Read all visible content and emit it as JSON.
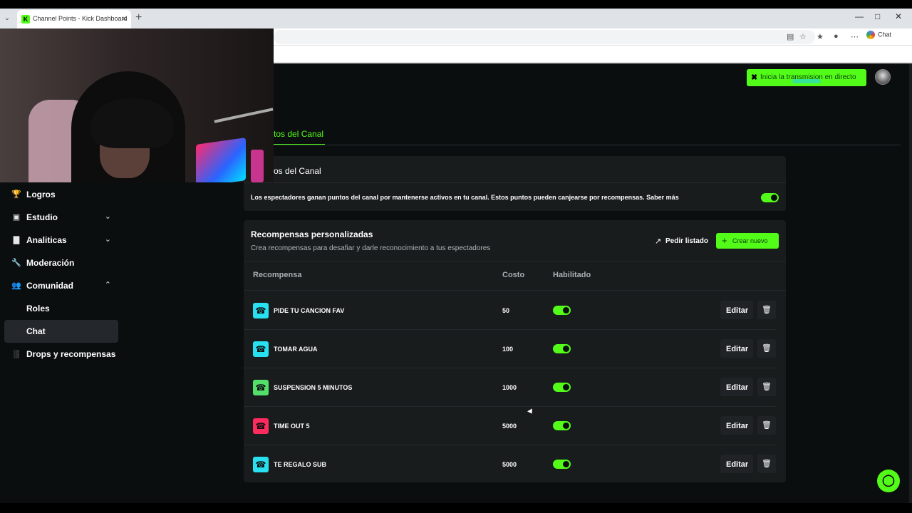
{
  "browser": {
    "tab_title": "Channel Points - Kick Dashboard",
    "tab_favicon": "K",
    "chat_label": "Chat",
    "window_controls": [
      "—",
      "□",
      "✕"
    ]
  },
  "header": {
    "live_button_label": "Inicia la transmision en directo"
  },
  "sidebar": {
    "items": [
      {
        "label": "Logros",
        "icon": "trophy-icon",
        "glyph": "🏆",
        "chevron": ""
      },
      {
        "label": "Estudio",
        "icon": "studio-icon",
        "glyph": "▣",
        "chevron": "⌄"
      },
      {
        "label": "Analiticas",
        "icon": "analytics-icon",
        "glyph": "▇",
        "chevron": "⌄"
      },
      {
        "label": "Moderación",
        "icon": "wrench-icon",
        "glyph": "🔧",
        "chevron": ""
      },
      {
        "label": "Comunidad",
        "icon": "community-icon",
        "glyph": "👥",
        "chevron": "⌃"
      },
      {
        "label": "Roles",
        "icon": "",
        "glyph": "",
        "chevron": ""
      },
      {
        "label": "Chat",
        "icon": "",
        "glyph": "",
        "chevron": ""
      },
      {
        "label": "Drops y recompensas",
        "icon": "drops-icon",
        "glyph": "░",
        "chevron": ""
      }
    ]
  },
  "main": {
    "active_tab": "tos del Canal",
    "points_card": {
      "title": "os del Canal",
      "description": "Los espectadores ganan puntos del canal por mantenerse activos en tu canal. Estos puntos pueden canjearse por recompensas. Saber más",
      "enabled": true
    },
    "rewards_card": {
      "title": "Recompensas personalizadas",
      "subtitle": "Crea recompensas para desafiar y darle reconocimiento a tus espectadores",
      "export_label": "Pedir listado",
      "create_label": "Crear nuevo",
      "columns": [
        "Recompensa",
        "Costo",
        "Habilitado"
      ],
      "rows": [
        {
          "name": "PIDE TU CANCION FAV",
          "cost": "50",
          "enabled": true,
          "color": "#28e0f0",
          "edit_label": "Editar"
        },
        {
          "name": "TOMAR AGUA",
          "cost": "100",
          "enabled": true,
          "color": "#28e0f0",
          "edit_label": "Editar"
        },
        {
          "name": "SUSPENSION 5 MINUTOS",
          "cost": "1000",
          "enabled": true,
          "color": "#53e06a",
          "edit_label": "Editar"
        },
        {
          "name": "TIME OUT 5",
          "cost": "5000",
          "enabled": true,
          "color": "#ff2a5e",
          "edit_label": "Editar"
        },
        {
          "name": "TE REGALO SUB",
          "cost": "5000",
          "enabled": true,
          "color": "#28e0f0",
          "edit_label": "Editar"
        }
      ]
    }
  },
  "colors": {
    "accent": "#53fc18",
    "background": "#0b0e0f",
    "card": "#191c1d"
  }
}
